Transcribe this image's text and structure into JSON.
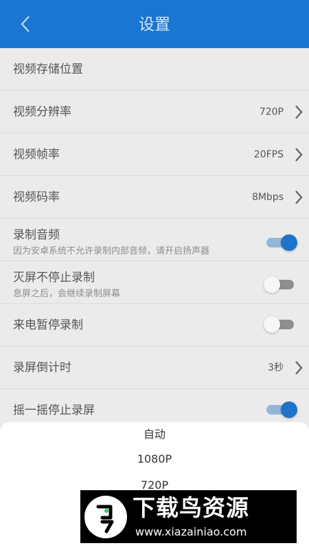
{
  "header": {
    "title": "设置",
    "back_icon": "chevron-left-icon"
  },
  "settings": [
    {
      "label": "视频存储位置"
    },
    {
      "label": "视频分辨率",
      "value": "720P",
      "chevron": true
    },
    {
      "label": "视频帧率",
      "value": "20FPS",
      "chevron": true
    },
    {
      "label": "视频码率",
      "value": "8Mbps",
      "chevron": true
    },
    {
      "label": "录制音频",
      "description": "因为安卓系统不允许录制内部音频，请开启扬声器",
      "toggle": "on"
    },
    {
      "label": "灭屏不停止录制",
      "description": "息屏之后，会继续录制屏幕",
      "toggle": "off"
    },
    {
      "label": "来电暂停录制",
      "toggle": "off"
    },
    {
      "label": "录屏倒计时",
      "value": "3秒",
      "chevron": true
    },
    {
      "label": "摇一摇停止录屏",
      "toggle": "on"
    }
  ],
  "resolution_sheet": {
    "options": [
      "自动",
      "1080P",
      "720P"
    ]
  },
  "watermark": {
    "title": "下载鸟资源",
    "url": "www.xiazainiao.com"
  },
  "colors": {
    "appbar": "#1976d2",
    "toggle_on": "#1e73c9",
    "overlay": "#ebebeb",
    "sheet": "#ffffff"
  }
}
